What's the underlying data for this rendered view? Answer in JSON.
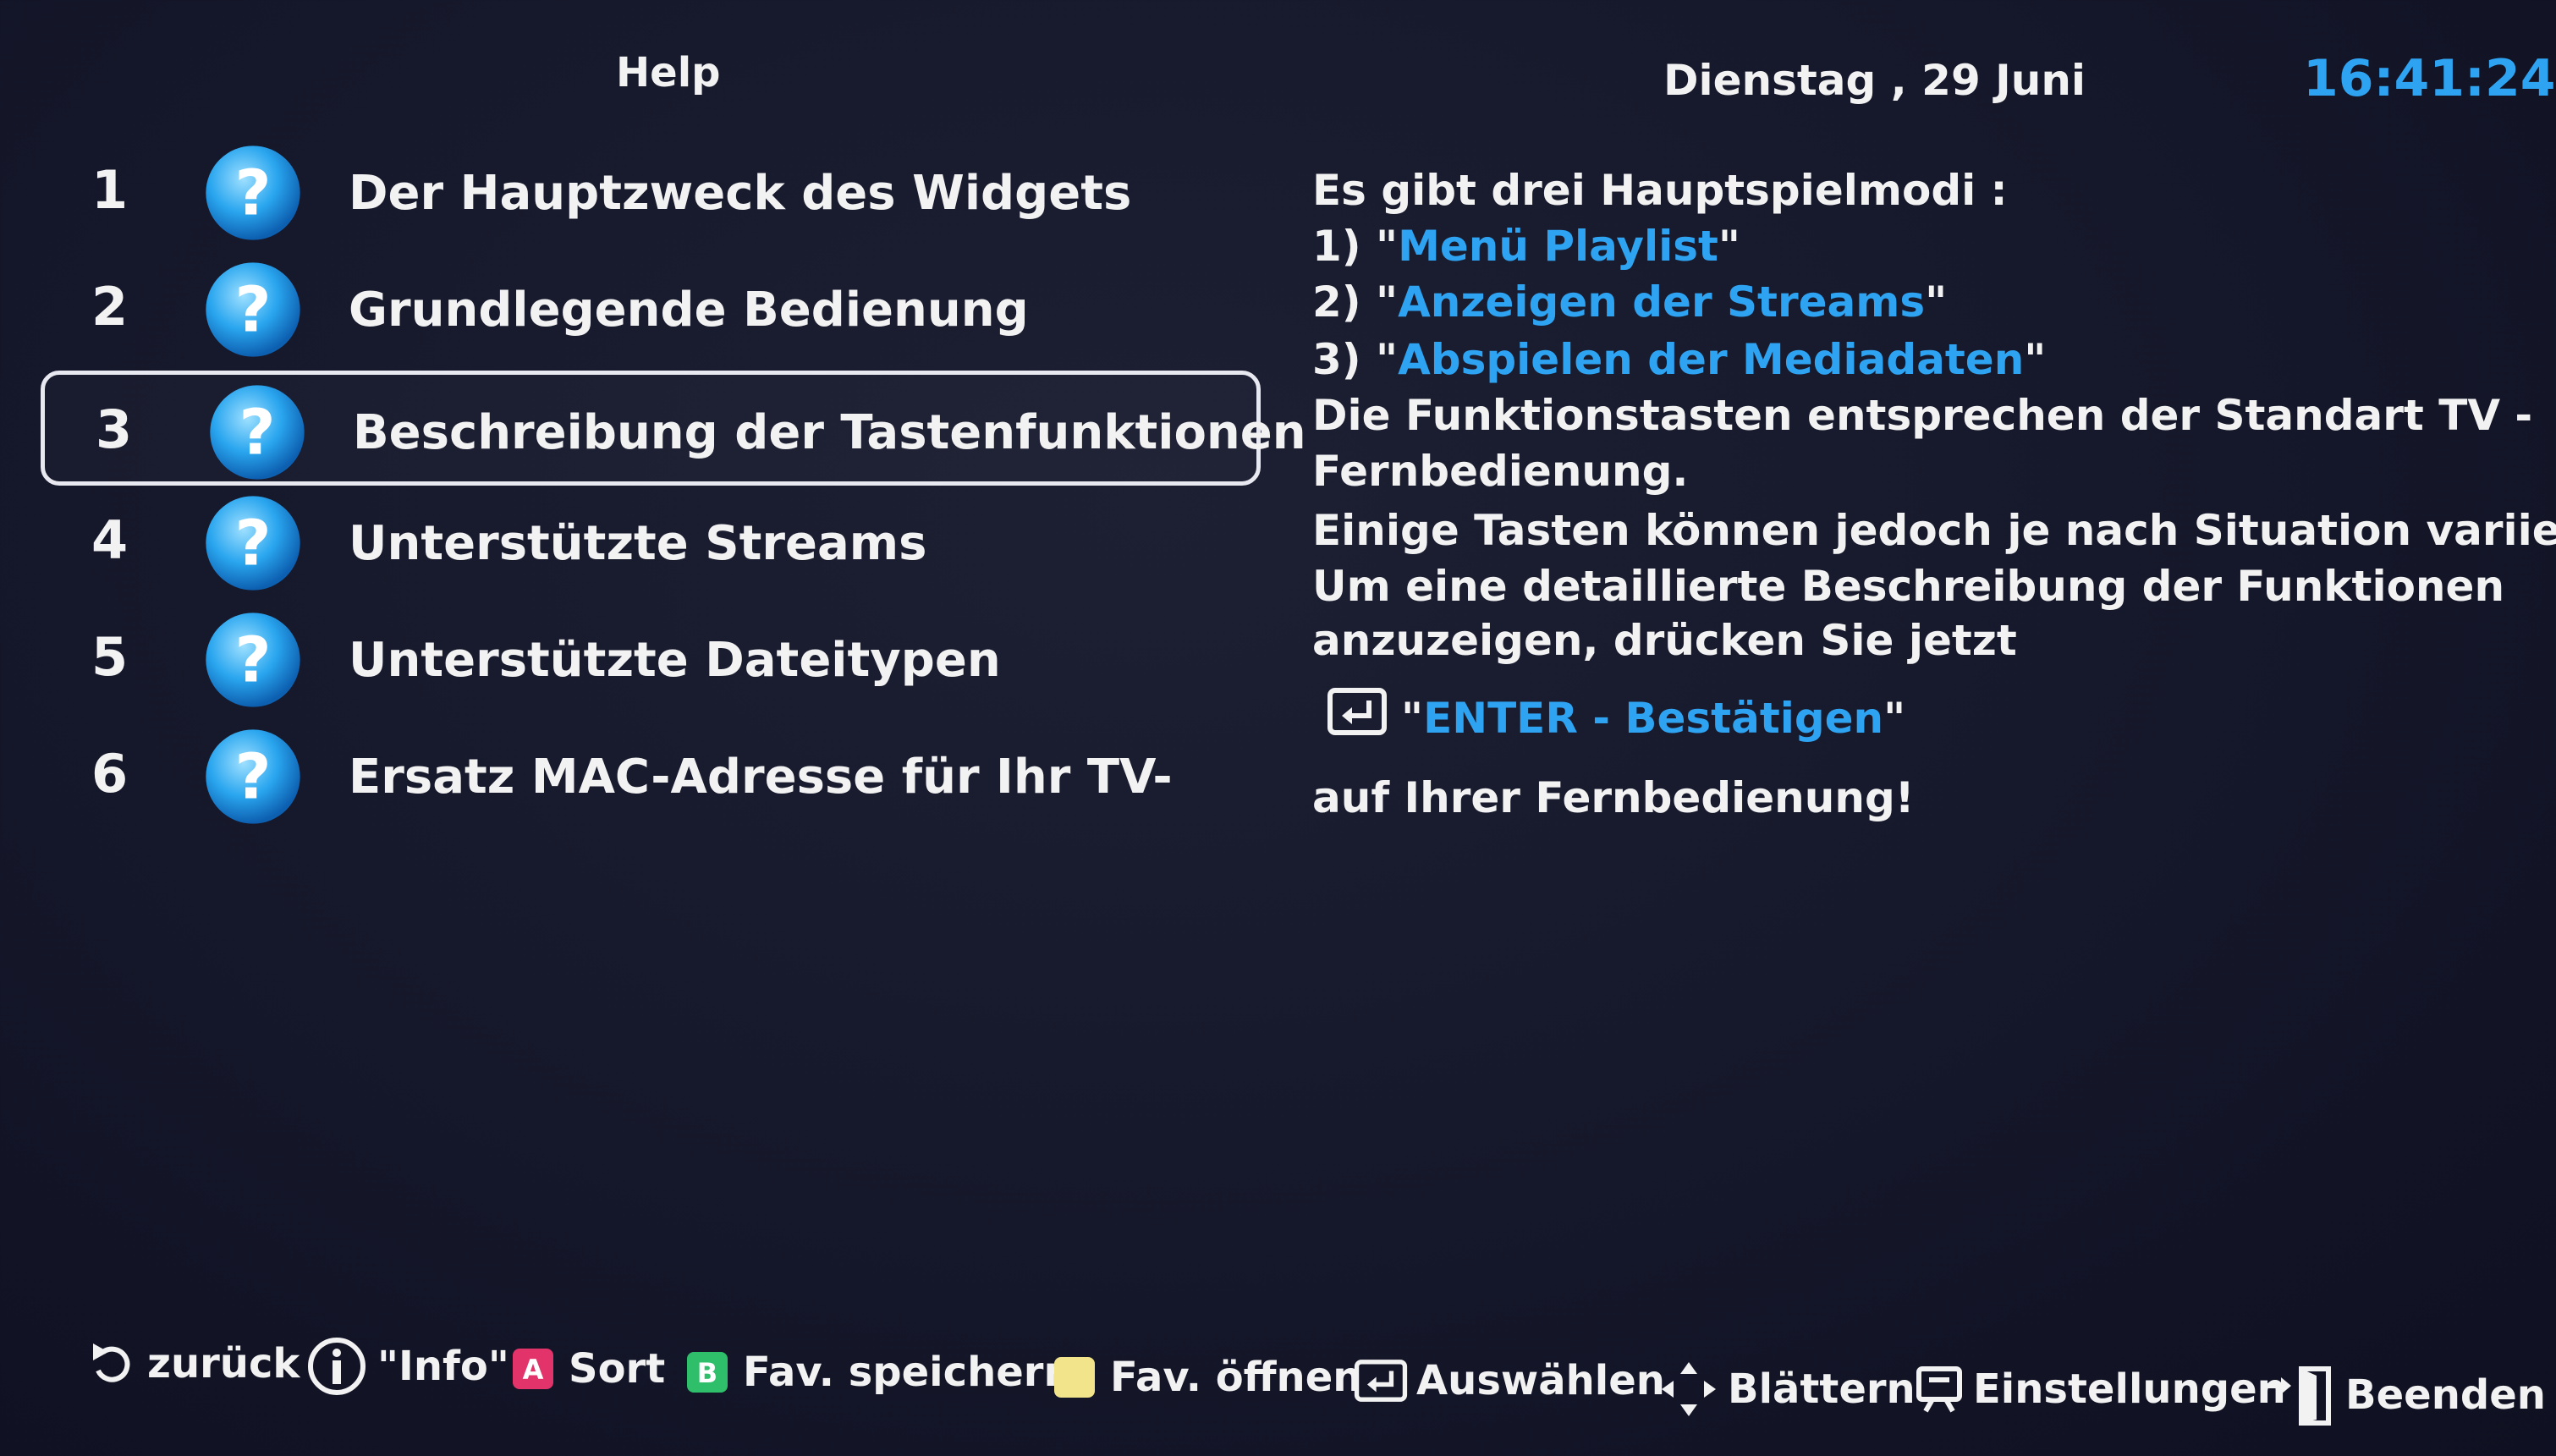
{
  "header": {
    "title": "Help",
    "date": "Dienstag , 29 Juni",
    "time": "16:41:24"
  },
  "menu": {
    "selected_index": 2,
    "items": [
      {
        "number": "1",
        "label": "Der Hauptzweck des Widgets",
        "icon": "question-icon"
      },
      {
        "number": "2",
        "label": "Grundlegende Bedienung",
        "icon": "question-icon"
      },
      {
        "number": "3",
        "label": "Beschreibung der Tastenfunktionen",
        "icon": "question-icon"
      },
      {
        "number": "4",
        "label": "Unterstützte Streams",
        "icon": "question-icon"
      },
      {
        "number": "5",
        "label": "Unterstützte Dateitypen",
        "icon": "question-icon"
      },
      {
        "number": "6",
        "label": "Ersatz MAC-Adresse für Ihr TV-",
        "icon": "question-icon"
      }
    ]
  },
  "description": {
    "intro": "Es gibt drei Hauptspielmodi :",
    "modes": [
      {
        "prefix": "1) \"",
        "name": "Menü Playlist",
        "suffix": "\""
      },
      {
        "prefix": "2) \"",
        "name": "Anzeigen der Streams",
        "suffix": "\""
      },
      {
        "prefix": "3) \"",
        "name": "Abspielen der Mediadaten",
        "suffix": "\""
      }
    ],
    "line1": "Die Funktionstasten entsprechen der Standart TV -",
    "line2": "Fernbedienung.",
    "line3": "Einige Tasten können jedoch je nach Situation variieren!",
    "line4": "Um eine detaillierte Beschreibung der Funktionen",
    "line5": "anzuzeigen, drücken Sie jetzt",
    "enter_quote_open": "\"",
    "enter_label": "ENTER - Bestätigen",
    "enter_quote_close": "\"",
    "line6": "auf Ihrer Fernbedienung!"
  },
  "footer": {
    "back": "zurück",
    "info": "\"Info\"",
    "sort_key": "A",
    "sort": "Sort",
    "fav_save_key": "B",
    "fav_save": "Fav. speichern",
    "fav_open": "Fav. öffnen",
    "select": "Auswählen",
    "scroll": "Blättern",
    "settings": "Einstellungen",
    "exit": "Beenden"
  },
  "colors": {
    "accent": "#2ea3f2",
    "background": "#15172a",
    "key_red": "#e2336b",
    "key_green": "#2fbf6a",
    "key_yellow": "#f2e48a"
  }
}
